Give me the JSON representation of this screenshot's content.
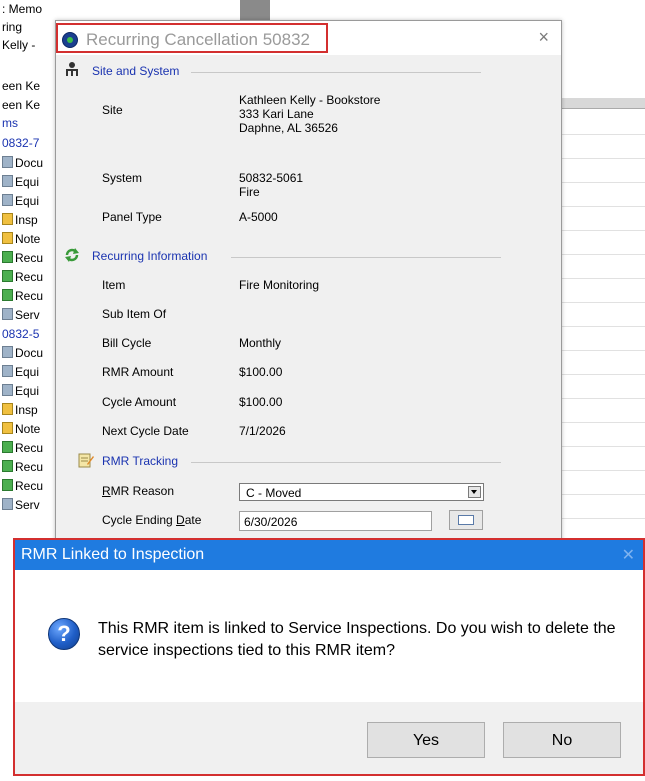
{
  "background_tree": {
    "items": [
      {
        "text": ": Memo",
        "top": 0
      },
      {
        "text": "ring",
        "top": 0
      },
      {
        "text": "Kelly -",
        "top": 0
      },
      {
        "text": "een Ke",
        "top": 0
      },
      {
        "text": "een Ke",
        "top": 0
      },
      {
        "text": "ms",
        "top": 0
      },
      {
        "text": "0832-7",
        "top": 0
      },
      {
        "text": "Docu",
        "top": 0
      },
      {
        "text": "Equi",
        "top": 0
      },
      {
        "text": "Equi",
        "top": 0
      },
      {
        "text": "Insp",
        "top": 0
      },
      {
        "text": "Note",
        "top": 0
      },
      {
        "text": "Recu",
        "top": 0
      },
      {
        "text": "Recu",
        "top": 0
      },
      {
        "text": "Recu",
        "top": 0
      },
      {
        "text": "Serv",
        "top": 0
      },
      {
        "text": "0832-5",
        "top": 0
      },
      {
        "text": "Docu",
        "top": 0
      },
      {
        "text": "Equi",
        "top": 0
      },
      {
        "text": "Equi",
        "top": 0
      },
      {
        "text": "Insp",
        "top": 0
      },
      {
        "text": "Note",
        "top": 0
      },
      {
        "text": "Recu",
        "top": 0
      },
      {
        "text": "Recu",
        "top": 0
      },
      {
        "text": "Recu",
        "top": 0
      },
      {
        "text": "Serv",
        "top": 0
      }
    ]
  },
  "recurring_window": {
    "title": "Recurring Cancellation 50832",
    "close_glyph": "×",
    "site_and_system": {
      "header": "Site and System",
      "site_label": "Site",
      "site_value": "Kathleen Kelly - Bookstore\n333 Kari Lane\nDaphne, AL  36526",
      "system_label": "System",
      "system_value": "50832-5061\nFire",
      "panel_type_label": "Panel Type",
      "panel_type_value": "A-5000"
    },
    "recurring_information": {
      "header": "Recurring Information",
      "item_label": "Item",
      "item_value": "Fire Monitoring",
      "sub_item_label": "Sub Item Of",
      "bill_cycle_label": "Bill Cycle",
      "bill_cycle_value": "Monthly",
      "rmr_amount_label": "RMR Amount",
      "rmr_amount_value": "$100.00",
      "cycle_amount_label": "Cycle Amount",
      "cycle_amount_value": "$100.00",
      "next_cycle_label": "Next Cycle Date",
      "next_cycle_value": "7/1/2026"
    },
    "rmr_tracking": {
      "header": "RMR Tracking",
      "reason_label_pre": "",
      "reason_label_u": "R",
      "reason_label_post": "MR Reason",
      "reason_value": "C - Moved",
      "cycle_end_label_pre": "Cycle Ending ",
      "cycle_end_label_u": "D",
      "cycle_end_label_post": "ate",
      "cycle_end_value": "6/30/2026"
    }
  },
  "dialog": {
    "title": "RMR Linked to Inspection",
    "close_glyph": "✕",
    "message": "This RMR item is linked to Service Inspections. Do you wish to delete the service inspections tied to this RMR item?",
    "icon_glyph": "?",
    "yes_label": "Yes",
    "no_label": "No"
  },
  "colors": {
    "highlight_border": "#d32f2f",
    "dialog_titlebar": "#1f7be0",
    "section_header_text": "#1a33b0"
  }
}
